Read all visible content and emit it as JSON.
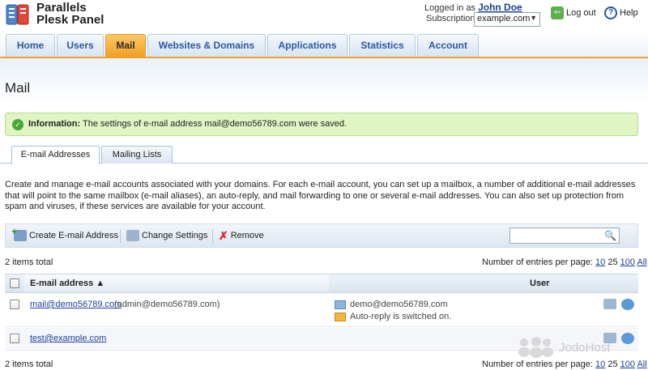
{
  "header": {
    "product_line1": "Parallels",
    "product_line2": "Plesk Panel",
    "logged_in_label": "Logged in as",
    "user_name": "John Doe",
    "subscription_label": "Subscription",
    "subscription_value": "example.com",
    "logout_label": "Log out",
    "help_label": "Help"
  },
  "nav": {
    "tabs": [
      "Home",
      "Users",
      "Mail",
      "Websites & Domains",
      "Applications",
      "Statistics",
      "Account"
    ],
    "active": "Mail"
  },
  "page": {
    "title": "Mail"
  },
  "info": {
    "label": "Information:",
    "message": "The settings of e-mail address mail@demo56789.com were saved."
  },
  "subtabs": [
    "E-mail Addresses",
    "Mailing Lists"
  ],
  "description": "Create and manage e-mail accounts associated with your domains. For each e-mail account, you can set up a mailbox, a number of additional e-mail addresses that will point to the same mailbox (e-mail aliases), an auto-reply, and mail forwarding to one or several e-mail addresses. You can also set up protection from spam and viruses, if these services are available for your account.",
  "toolbar": {
    "create_label": "Create E-mail Address",
    "change_label": "Change Settings",
    "remove_label": "Remove",
    "search_value": ""
  },
  "list": {
    "total_label": "2 items total",
    "per_page_label": "Number of entries per page:",
    "per_page_options": [
      "10",
      "25",
      "100",
      "All"
    ],
    "per_page_selected": "25",
    "columns": {
      "email": "E-mail address ▲",
      "user": "User"
    },
    "rows": [
      {
        "email": "mail@demo56789.com",
        "alias": "(admin@demo56789.com)",
        "forward": "demo@demo56789.com",
        "autoreply": "Auto-reply is switched on."
      },
      {
        "email": "test@example.com",
        "alias": "",
        "forward": "",
        "autoreply": ""
      }
    ]
  },
  "watermark": "JodoHost",
  "colors": {
    "active_tab": "#f2a024",
    "link": "#1a3f9c",
    "info_bg": "#dff5c4"
  }
}
